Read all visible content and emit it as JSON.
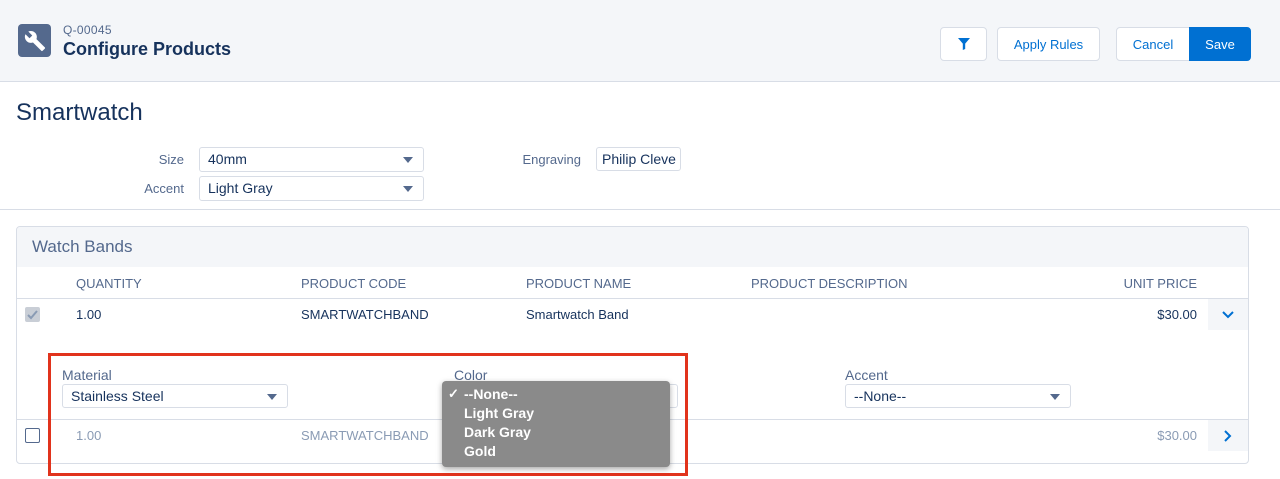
{
  "header": {
    "quote_number": "Q-00045",
    "title": "Configure Products",
    "apply_rules_label": "Apply Rules",
    "cancel_label": "Cancel",
    "save_label": "Save",
    "app_icon": "wrench-icon",
    "filter_icon": "filter-icon"
  },
  "product": {
    "title": "Smartwatch",
    "size_label": "Size",
    "size_value": "40mm",
    "accent_label": "Accent",
    "accent_value": "Light Gray",
    "engraving_label": "Engraving",
    "engraving_value": "Philip Cleve"
  },
  "watch_bands": {
    "title": "Watch Bands",
    "columns": [
      "QUANTITY",
      "PRODUCT CODE",
      "PRODUCT NAME",
      "PRODUCT DESCRIPTION",
      "UNIT PRICE"
    ],
    "rows": [
      {
        "quantity": "1.00",
        "code": "SMARTWATCHBAND",
        "name": "Smartwatch Band",
        "description": "",
        "unit_price": "$30.00",
        "checked": true,
        "expanded": true
      },
      {
        "quantity": "1.00",
        "code": "SMARTWATCHBAND",
        "name": "",
        "description": "",
        "unit_price": "$30.00",
        "checked": false,
        "expanded": false
      }
    ],
    "config": {
      "material_label": "Material",
      "material_value": "Stainless Steel",
      "color_label": "Color",
      "accent_label": "Accent",
      "accent_value": "--None--"
    }
  },
  "color_dropdown": {
    "options": [
      "--None--",
      "Light Gray",
      "Dark Gray",
      "Gold"
    ],
    "selected": "--None--"
  },
  "colors": {
    "brand_blue": "#0070d2",
    "highlight_red": "#e1331c",
    "dropdown_bg": "#8a8a8a"
  }
}
